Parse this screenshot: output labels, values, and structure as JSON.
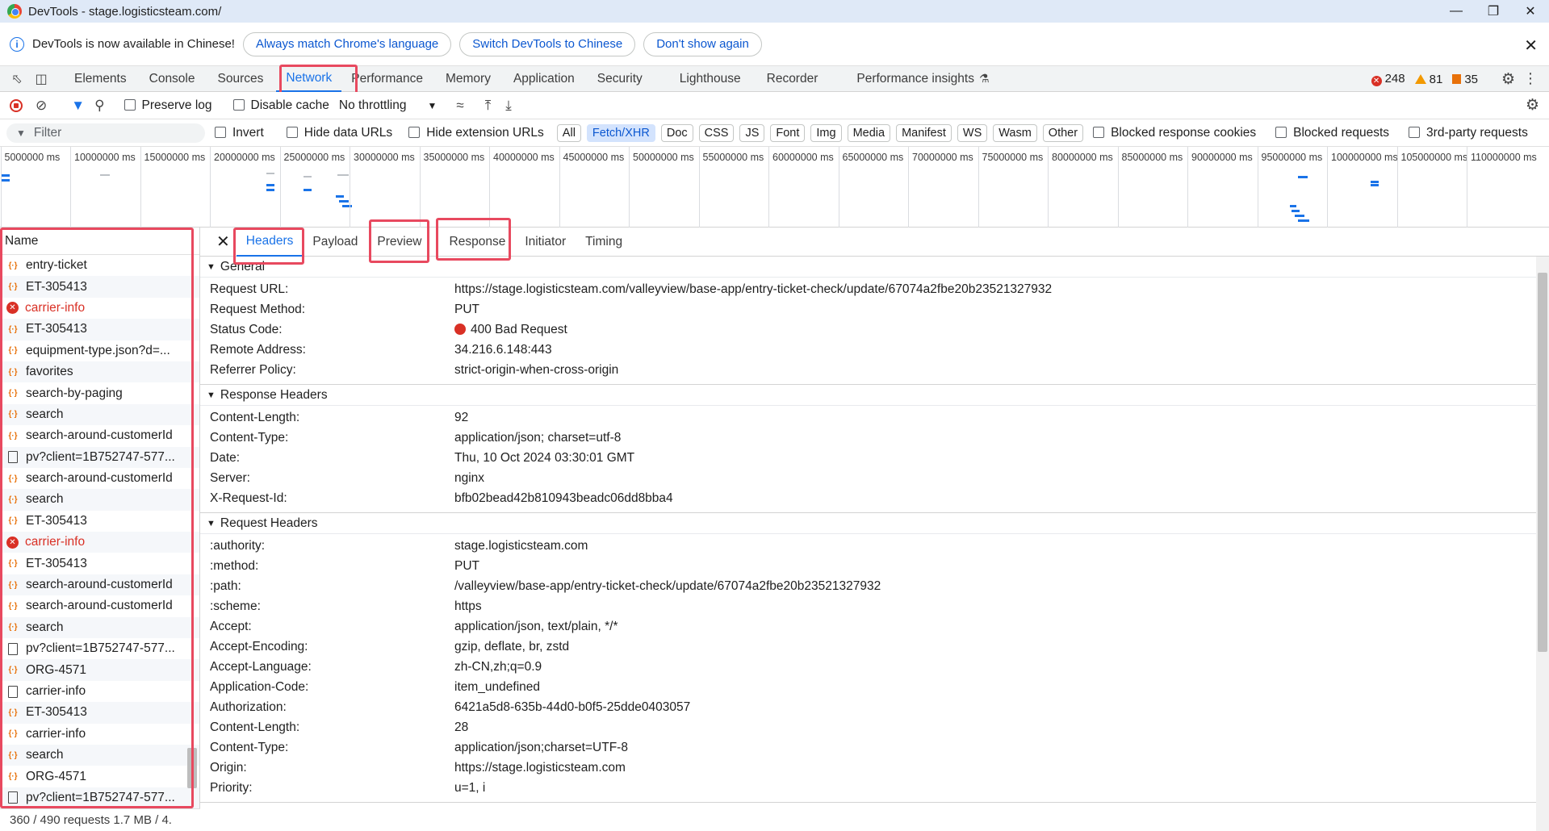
{
  "window": {
    "title": "DevTools - stage.logisticsteam.com/"
  },
  "infobar": {
    "message": "DevTools is now available in Chinese!",
    "btn_match": "Always match Chrome's language",
    "btn_switch": "Switch DevTools to Chinese",
    "btn_dont": "Don't show again"
  },
  "tabs": [
    "Elements",
    "Console",
    "Sources",
    "Network",
    "Performance",
    "Memory",
    "Application",
    "Security",
    "Lighthouse",
    "Recorder",
    "Performance insights"
  ],
  "active_tab": "Network",
  "issues": {
    "errors": "248",
    "warnings": "81",
    "info": "35"
  },
  "toolbar": {
    "preserve_log": "Preserve log",
    "disable_cache": "Disable cache",
    "throttling": "No throttling"
  },
  "filterbar": {
    "filter_placeholder": "Filter",
    "invert": "Invert",
    "hide_data_urls": "Hide data URLs",
    "hide_ext_urls": "Hide extension URLs",
    "types": [
      "All",
      "Fetch/XHR",
      "Doc",
      "CSS",
      "JS",
      "Font",
      "Img",
      "Media",
      "Manifest",
      "WS",
      "Wasm",
      "Other"
    ],
    "active_type": "Fetch/XHR",
    "blocked_cookies": "Blocked response cookies",
    "blocked_requests": "Blocked requests",
    "third_party": "3rd-party requests"
  },
  "timeline_ticks": [
    "5000000 ms",
    "10000000 ms",
    "15000000 ms",
    "20000000 ms",
    "25000000 ms",
    "30000000 ms",
    "35000000 ms",
    "40000000 ms",
    "45000000 ms",
    "50000000 ms",
    "55000000 ms",
    "60000000 ms",
    "65000000 ms",
    "70000000 ms",
    "75000000 ms",
    "80000000 ms",
    "85000000 ms",
    "90000000 ms",
    "95000000 ms",
    "100000000 ms",
    "105000000 ms",
    "110000000 ms"
  ],
  "requests": {
    "header": "Name",
    "rows": [
      {
        "name": "entry-ticket",
        "type": "xhr"
      },
      {
        "name": "ET-305413",
        "type": "xhr"
      },
      {
        "name": "carrier-info",
        "type": "err"
      },
      {
        "name": "ET-305413",
        "type": "xhr"
      },
      {
        "name": "equipment-type.json?d=...",
        "type": "xhr"
      },
      {
        "name": "favorites",
        "type": "xhr"
      },
      {
        "name": "search-by-paging",
        "type": "xhr"
      },
      {
        "name": "search",
        "type": "xhr"
      },
      {
        "name": "search-around-customerId",
        "type": "xhr"
      },
      {
        "name": "pv?client=1B752747-577...",
        "type": "doc"
      },
      {
        "name": "search-around-customerId",
        "type": "xhr"
      },
      {
        "name": "search",
        "type": "xhr"
      },
      {
        "name": "ET-305413",
        "type": "xhr"
      },
      {
        "name": "carrier-info",
        "type": "err"
      },
      {
        "name": "ET-305413",
        "type": "xhr"
      },
      {
        "name": "search-around-customerId",
        "type": "xhr"
      },
      {
        "name": "search-around-customerId",
        "type": "xhr"
      },
      {
        "name": "search",
        "type": "xhr"
      },
      {
        "name": "pv?client=1B752747-577...",
        "type": "doc"
      },
      {
        "name": "ORG-4571",
        "type": "xhr"
      },
      {
        "name": "carrier-info",
        "type": "doc"
      },
      {
        "name": "ET-305413",
        "type": "xhr"
      },
      {
        "name": "carrier-info",
        "type": "xhr"
      },
      {
        "name": "search",
        "type": "xhr"
      },
      {
        "name": "ORG-4571",
        "type": "xhr"
      },
      {
        "name": "pv?client=1B752747-577...",
        "type": "doc"
      }
    ],
    "status": "360 / 490 requests    1.7 MB / 4."
  },
  "detail_tabs": [
    "Headers",
    "Payload",
    "Preview",
    "Response",
    "Initiator",
    "Timing"
  ],
  "active_detail_tab": "Headers",
  "general": {
    "title": "General",
    "items": [
      {
        "k": "Request URL:",
        "v": "https://stage.logisticsteam.com/valleyview/base-app/entry-ticket-check/update/67074a2fbe20b23521327932"
      },
      {
        "k": "Request Method:",
        "v": "PUT"
      },
      {
        "k": "Status Code:",
        "v": "400 Bad Request"
      },
      {
        "k": "Remote Address:",
        "v": "34.216.6.148:443"
      },
      {
        "k": "Referrer Policy:",
        "v": "strict-origin-when-cross-origin"
      }
    ]
  },
  "response_headers": {
    "title": "Response Headers",
    "items": [
      {
        "k": "Content-Length:",
        "v": "92"
      },
      {
        "k": "Content-Type:",
        "v": "application/json; charset=utf-8"
      },
      {
        "k": "Date:",
        "v": "Thu, 10 Oct 2024 03:30:01 GMT"
      },
      {
        "k": "Server:",
        "v": "nginx"
      },
      {
        "k": "X-Request-Id:",
        "v": "bfb02bead42b810943beadc06dd8bba4"
      }
    ]
  },
  "request_headers": {
    "title": "Request Headers",
    "items": [
      {
        "k": ":authority:",
        "v": "stage.logisticsteam.com"
      },
      {
        "k": ":method:",
        "v": "PUT"
      },
      {
        "k": ":path:",
        "v": "/valleyview/base-app/entry-ticket-check/update/67074a2fbe20b23521327932"
      },
      {
        "k": ":scheme:",
        "v": "https"
      },
      {
        "k": "Accept:",
        "v": "application/json, text/plain, */*"
      },
      {
        "k": "Accept-Encoding:",
        "v": "gzip, deflate, br, zstd"
      },
      {
        "k": "Accept-Language:",
        "v": "zh-CN,zh;q=0.9"
      },
      {
        "k": "Application-Code:",
        "v": "item_undefined"
      },
      {
        "k": "Authorization:",
        "v": "6421a5d8-635b-44d0-b0f5-25dde0403057"
      },
      {
        "k": "Content-Length:",
        "v": "28"
      },
      {
        "k": "Content-Type:",
        "v": "application/json;charset=UTF-8"
      },
      {
        "k": "Origin:",
        "v": "https://stage.logisticsteam.com"
      },
      {
        "k": "Priority:",
        "v": "u=1, i"
      }
    ]
  }
}
